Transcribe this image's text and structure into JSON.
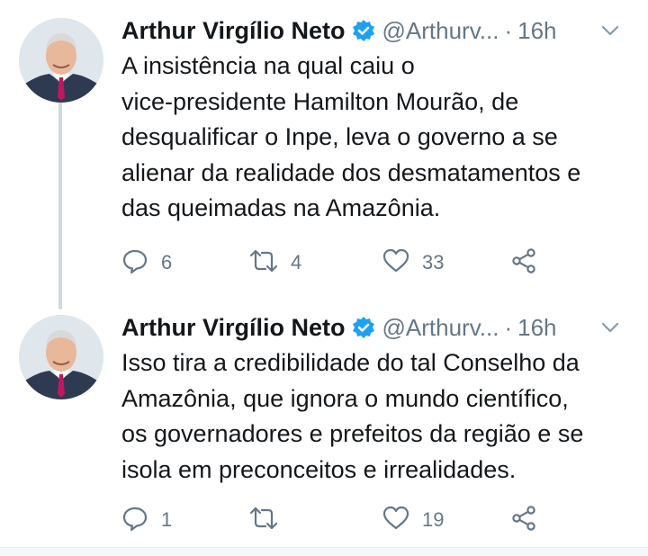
{
  "colors": {
    "text": "#14171a",
    "muted": "#657786",
    "verified": "#1da1f2",
    "icon": "#657786",
    "thread_line": "#cfd9de"
  },
  "tweets": [
    {
      "display_name": "Arthur Virgílio Neto",
      "verified_icon": "verified-badge-icon",
      "handle": "@Arthurv...",
      "separator": "·",
      "time": "16h",
      "lines": [
        "A insistência na qual caiu o",
        "vice-presidente Hamilton Mourão, de",
        "desqualificar o Inpe, leva o governo a se",
        "alienar da realidade dos desmatamentos e",
        "das queimadas na Amazônia."
      ],
      "actions": {
        "reply_count": "6",
        "retweet_count": "4",
        "like_count": "33"
      }
    },
    {
      "display_name": "Arthur Virgílio Neto",
      "verified_icon": "verified-badge-icon",
      "handle": "@Arthurv...",
      "separator": "·",
      "time": "16h",
      "lines": [
        "Isso tira a credibilidade do tal Conselho da",
        "Amazônia, que ignora o mundo científico,",
        "os governadores e prefeitos da região e se",
        "isola em preconceitos e irrealidades."
      ],
      "actions": {
        "reply_count": "1",
        "retweet_count": "",
        "like_count": "19"
      }
    }
  ]
}
